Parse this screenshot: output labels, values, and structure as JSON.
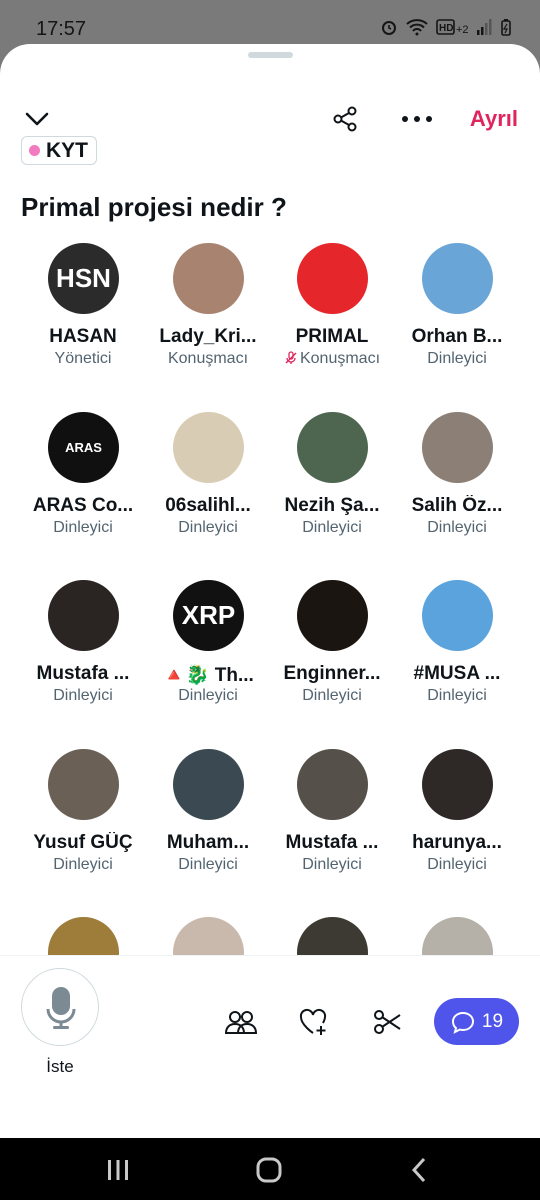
{
  "status_bar": {
    "time": "17:57",
    "icons": [
      "alarm-icon",
      "wifi-icon",
      "hd-icon",
      "signal-icon",
      "battery-icon"
    ]
  },
  "header": {
    "leave_label": "Ayrıl"
  },
  "space": {
    "tag": "KYT",
    "tag_color": "#f27bbf",
    "title": "Primal projesi nedir ?"
  },
  "participants": [
    {
      "name": "HASAN",
      "role": "Yönetici",
      "avatar": "#2b2b2b",
      "initials": "HSN"
    },
    {
      "name": "Lady_Kri...",
      "role": "Konuşmacı",
      "avatar": "#a88470"
    },
    {
      "name": "PRIMAL",
      "role": "Konuşmacı",
      "avatar": "#e5262b",
      "muted": true
    },
    {
      "name": "Orhan B...",
      "role": "Dinleyici",
      "avatar": "#6aa5d8"
    },
    {
      "name": "ARAS Co...",
      "role": "Dinleyici",
      "avatar": "#101010",
      "initials": "ARAS"
    },
    {
      "name": "06salihl...",
      "role": "Dinleyici",
      "avatar": "#d9ccb4"
    },
    {
      "name": "Nezih Şa...",
      "role": "Dinleyici",
      "avatar": "#4e6650"
    },
    {
      "name": "Salih Öz...",
      "role": "Dinleyici",
      "avatar": "#8b7f76"
    },
    {
      "name": "Mustafa ...",
      "role": "Dinleyici",
      "avatar": "#2a2523"
    },
    {
      "name": "🔺🐉 Th...",
      "role": "Dinleyici",
      "avatar": "#111111",
      "initials": "XRP"
    },
    {
      "name": "Enginner...",
      "role": "Dinleyici",
      "avatar": "#1a1510"
    },
    {
      "name": "#MUSA ...",
      "role": "Dinleyici",
      "avatar": "#5aa3dc"
    },
    {
      "name": "Yusuf GÜÇ",
      "role": "Dinleyici",
      "avatar": "#6b6055"
    },
    {
      "name": "Muham...",
      "role": "Dinleyici",
      "avatar": "#3b4a52"
    },
    {
      "name": "Mustafa ...",
      "role": "Dinleyici",
      "avatar": "#555049"
    },
    {
      "name": "harunya...",
      "role": "Dinleyici",
      "avatar": "#2e2926"
    },
    {
      "name": "",
      "role": "",
      "avatar": "#9e7c3a"
    },
    {
      "name": "",
      "role": "",
      "avatar": "#c9b9ad"
    },
    {
      "name": "",
      "role": "",
      "avatar": "#3c3a33"
    },
    {
      "name": "",
      "role": "",
      "avatar": "#b5b0a8"
    }
  ],
  "bottom_bar": {
    "mic_label": "İste",
    "comment_count": "19",
    "accent": "#4f55ea"
  }
}
